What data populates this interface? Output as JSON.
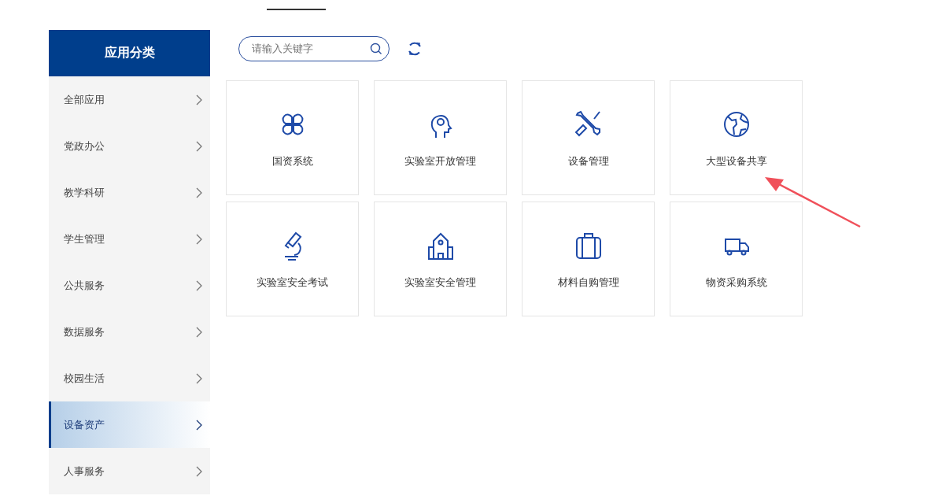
{
  "sidebar": {
    "title": "应用分类",
    "items": [
      {
        "label": "全部应用",
        "selected": false
      },
      {
        "label": "党政办公",
        "selected": false
      },
      {
        "label": "教学科研",
        "selected": false
      },
      {
        "label": "学生管理",
        "selected": false
      },
      {
        "label": "公共服务",
        "selected": false
      },
      {
        "label": "数据服务",
        "selected": false
      },
      {
        "label": "校园生活",
        "selected": false
      },
      {
        "label": "设备资产",
        "selected": true
      },
      {
        "label": "人事服务",
        "selected": false
      }
    ]
  },
  "search": {
    "placeholder": "请输入关键字"
  },
  "apps": [
    {
      "label": "国资系统"
    },
    {
      "label": "实验室开放管理"
    },
    {
      "label": "设备管理"
    },
    {
      "label": "大型设备共享"
    },
    {
      "label": "实验室安全考试"
    },
    {
      "label": "实验室安全管理"
    },
    {
      "label": "材料自购管理"
    },
    {
      "label": "物资采购系统"
    }
  ]
}
